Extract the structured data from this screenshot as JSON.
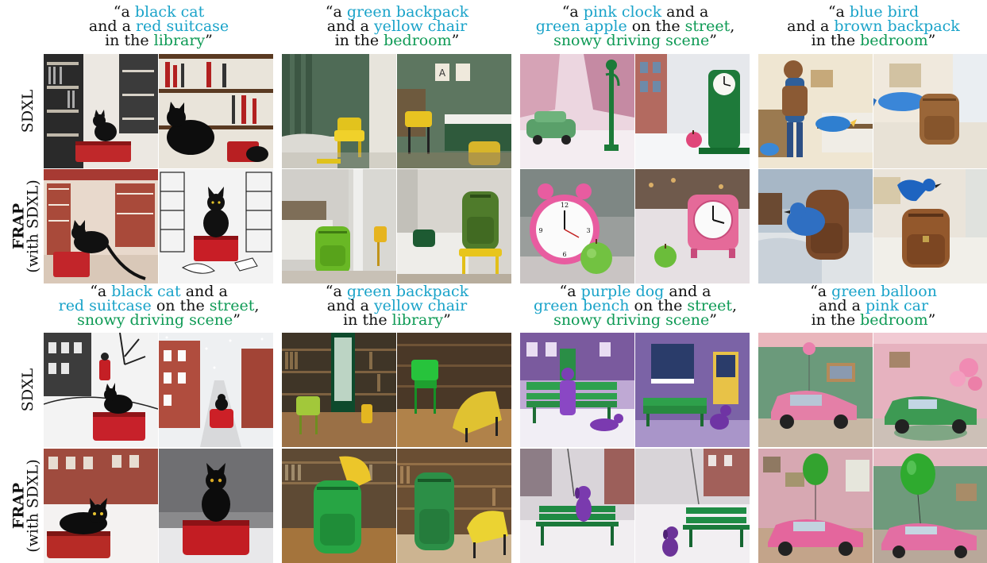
{
  "row_labels": {
    "sdxl": "SDXL",
    "frap_line1": "FRAP",
    "frap_line2": "(with SDXL)"
  },
  "prompts": [
    {
      "q_open": "“a ",
      "obj1": "black cat",
      "mid1": "and a ",
      "obj2": "red suitcase",
      "mid2": "in the ",
      "scene": "library",
      "q_close": "”"
    },
    {
      "q_open": "“a ",
      "obj1": "green backpack",
      "mid1": "and a ",
      "obj2": "yellow chair",
      "mid2": "in the ",
      "scene": "bedroom",
      "q_close": "”"
    },
    {
      "q_open": "“a ",
      "obj1": "pink clock",
      "mid1": " and a",
      "obj2": "green apple",
      "mid2": " on the ",
      "scene": "street",
      "comma": ",",
      "scene2": "snowy driving scene",
      "q_close": "”"
    },
    {
      "q_open": "“a ",
      "obj1": "blue bird",
      "mid1": "and a ",
      "obj2": "brown backpack",
      "mid2": "in the ",
      "scene": "bedroom",
      "q_close": "”"
    },
    {
      "q_open": "“a ",
      "obj1": "black cat",
      "mid1": " and a",
      "obj2": "red suitcase",
      "mid2": " on the ",
      "scene": "street",
      "comma": ",",
      "scene2": "snowy driving scene",
      "q_close": "”"
    },
    {
      "q_open": "“a ",
      "obj1": "green backpack",
      "mid1": "and a ",
      "obj2": "yellow chair",
      "mid2": "in the ",
      "scene": "library",
      "q_close": "”"
    },
    {
      "q_open": "“a ",
      "obj1": "purple dog",
      "mid1": " and a",
      "obj2": "green bench",
      "mid2": " on the ",
      "scene": "street",
      "comma": ",",
      "scene2": "snowy driving scene",
      "q_close": "”"
    },
    {
      "q_open": "“a ",
      "obj1": "green balloon",
      "mid1": "and a ",
      "obj2": "pink car",
      "mid2": "in the ",
      "scene": "bedroom",
      "q_close": "”"
    }
  ],
  "palette": {
    "object_text": "#1aa3c9",
    "scene_text": "#0e9a55"
  }
}
